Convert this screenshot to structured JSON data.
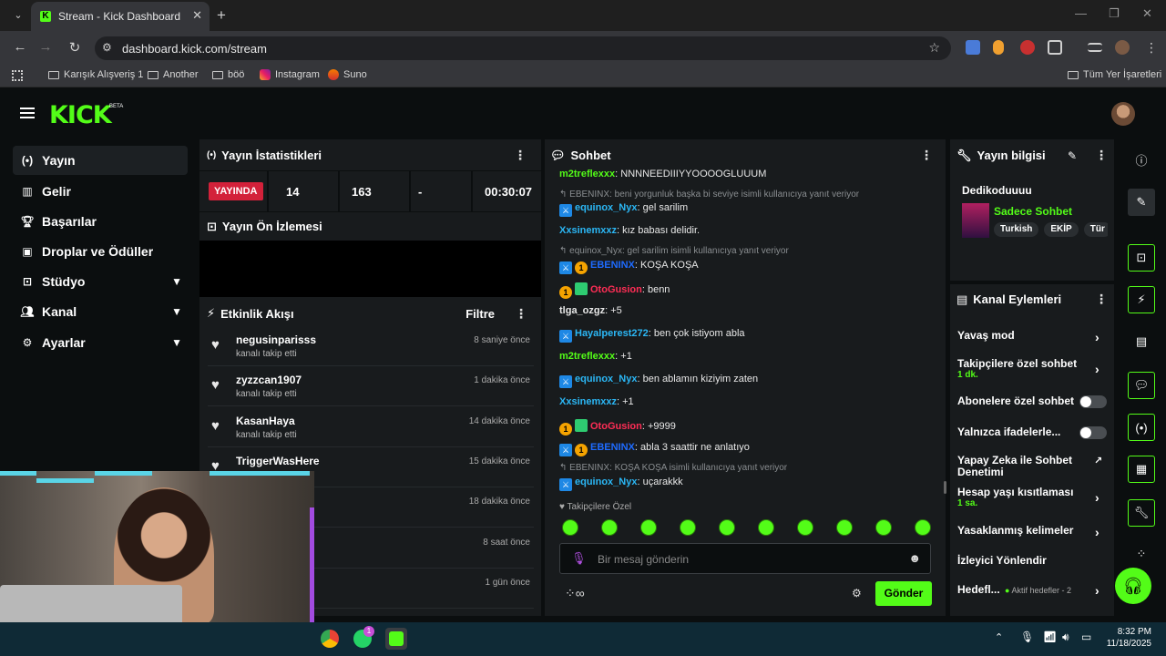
{
  "browser": {
    "tab_title": "Stream - Kick Dashboard",
    "favicon_letter": "K",
    "url": "dashboard.kick.com/stream",
    "bookmarks": [
      "Karışık Alışveriş 1",
      "Another",
      "böö",
      "Instagram",
      "Suno"
    ],
    "all_bookmarks": "Tüm Yer İşaretleri"
  },
  "header": {
    "logo": "KICK",
    "beta": "BETA"
  },
  "sidebar": {
    "items": [
      {
        "label": "Yayın",
        "icon": "broadcast-icon",
        "active": true
      },
      {
        "label": "Gelir",
        "icon": "chart-icon"
      },
      {
        "label": "Başarılar",
        "icon": "trophy-icon"
      },
      {
        "label": "Droplar ve Ödüller",
        "icon": "gift-icon"
      },
      {
        "label": "Stüdyo",
        "icon": "studio-icon",
        "expand": true
      },
      {
        "label": "Kanal",
        "icon": "users-icon",
        "expand": true
      },
      {
        "label": "Ayarlar",
        "icon": "gear-icon",
        "expand": true
      }
    ]
  },
  "stats": {
    "title": "Yayın İstatistikleri",
    "live": "YAYINDA",
    "viewers": "14",
    "followers": "163",
    "subs": "-",
    "uptime": "00:30:07"
  },
  "preview": {
    "title": "Yayın Ön İzlemesi"
  },
  "activity": {
    "title": "Etkinlik Akışı",
    "filter": "Filtre",
    "items": [
      {
        "name": "negusinparisss",
        "sub": "kanalı takip etti",
        "time": "8 saniye önce"
      },
      {
        "name": "zyzzcan1907",
        "sub": "kanalı takip etti",
        "time": "1 dakika önce"
      },
      {
        "name": "KasanHaya",
        "sub": "kanalı takip etti",
        "time": "14 dakika önce"
      },
      {
        "name": "TriggerWasHere",
        "sub": "",
        "time": "15 dakika önce"
      },
      {
        "name": "",
        "sub": "",
        "time": "18 dakika önce"
      },
      {
        "name": "",
        "sub": "",
        "time": "8 saat önce"
      },
      {
        "name": "",
        "sub": "",
        "time": "1 gün önce"
      }
    ]
  },
  "chat": {
    "title": "Sohbet",
    "follower_only": "Takipçilere Özel",
    "placeholder": "Bir mesaj gönderin",
    "send": "Gönder",
    "messages": [
      {
        "user": "m2treflexxx",
        "text": "NNNNEEDIIIYYOOOOGLUUUM",
        "color": "#53fc18"
      },
      {
        "reply": "EBENINX: beni yorgunluk başka bi seviye isimli kullanıcıya yanıt veriyor"
      },
      {
        "user": "equinox_Nyx",
        "text": "gel sarilim",
        "color": "#2bb7f5",
        "mod": true
      },
      {
        "user": "Xxsinemxxz",
        "text": "kız babası delidir.",
        "color": "#2bb7f5"
      },
      {
        "reply": "equinox_Nyx: gel sarilim isimli kullanıcıya yanıt veriyor"
      },
      {
        "user": "EBENINX",
        "text": "KOŞA KOŞA",
        "color": "#1e6bff",
        "mod": true,
        "sub": true
      },
      {
        "user": "OtoGusion",
        "text": "benn",
        "color": "#ff2d55",
        "sub": true,
        "gift": true
      },
      {
        "user": "tlga_ozgz",
        "text": "+5",
        "color": "#e8e8e8"
      },
      {
        "user": "Hayalperest272",
        "text": "ben çok istiyom abla",
        "color": "#2bb7f5",
        "mod": true
      },
      {
        "user": "m2treflexxx",
        "text": "+1",
        "color": "#53fc18"
      },
      {
        "user": "equinox_Nyx",
        "text": "ben ablamın kiziyim zaten",
        "color": "#2bb7f5",
        "mod": true
      },
      {
        "user": "Xxsinemxxz",
        "text": "+1",
        "color": "#2bb7f5"
      },
      {
        "user": "OtoGusion",
        "text": "+9999",
        "color": "#ff2d55",
        "sub": true,
        "gift": true
      },
      {
        "user": "EBENINX",
        "text": "abla 3 saattir ne anlatıyo",
        "color": "#1e6bff",
        "mod": true,
        "sub": true
      },
      {
        "reply": "EBENINX: KOŞA KOŞA isimli kullanıcıya yanıt veriyor"
      },
      {
        "user": "equinox_Nyx",
        "text": "uçarakkk",
        "color": "#2bb7f5",
        "mod": true
      }
    ]
  },
  "info": {
    "title": "Yayın bilgisi",
    "stream_title": "Dedikoduuuu",
    "category": "Sadece Sohbet",
    "tags": [
      "Turkish",
      "EKİP",
      "Tür"
    ]
  },
  "actions": {
    "title": "Kanal Eylemleri",
    "items": [
      {
        "label": "Yavaş mod",
        "kind": "chev"
      },
      {
        "label": "Takipçilere özel sohbet",
        "value": "1 dk.",
        "kind": "chev"
      },
      {
        "label": "Abonelere özel sohbet",
        "kind": "toggle"
      },
      {
        "label": "Yalnızca ifadelerle...",
        "kind": "toggle"
      },
      {
        "label": "Yapay Zeka ile Sohbet Denetimi",
        "kind": "ext"
      },
      {
        "label": "Hesap yaşı kısıtlaması",
        "value": "1 sa.",
        "kind": "chev"
      },
      {
        "label": "Yasaklanmış kelimeler",
        "kind": "chev"
      },
      {
        "label": "İzleyici Yönlendir",
        "kind": "none"
      },
      {
        "label": "Hedefl...",
        "value": "Aktif hedefler - 2",
        "kind": "chev"
      }
    ]
  },
  "taskbar": {
    "time": "8:32 PM",
    "date": "11/18/2025",
    "whatsapp_badge": "1"
  },
  "colors": {
    "accent": "#53fc18",
    "live": "#d3213a",
    "panel": "#181b1d",
    "bg": "#0b0e0f"
  }
}
